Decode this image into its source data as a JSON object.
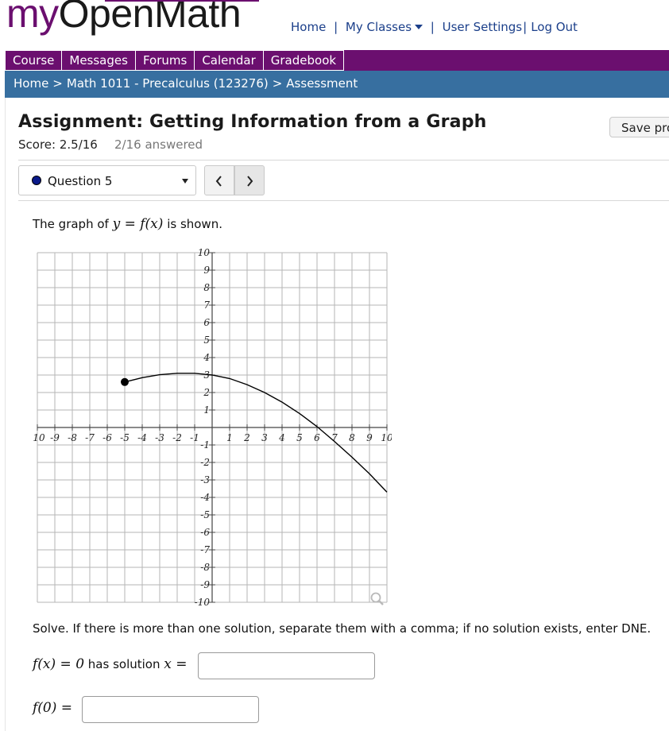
{
  "logo": {
    "my": "my",
    "rest": "OpenMath"
  },
  "topnav": {
    "home": "Home",
    "sep1": "|",
    "my_classes": "My Classes",
    "sep2": "|",
    "user_settings": "User Settings",
    "sep3": "|",
    "logout": "Log Out"
  },
  "tabs": [
    "Course",
    "Messages",
    "Forums",
    "Calendar",
    "Gradebook"
  ],
  "breadcrumb": {
    "home": "Home",
    "course": "Math 1011 - Precalculus (123276)",
    "current": "Assessment",
    "separator": ">"
  },
  "assignment": {
    "title": "Assignment: Getting Information from a Graph",
    "score": "Score: 2.5/16",
    "answered": "2/16 answered",
    "save_label": "Save pro"
  },
  "question_nav": {
    "selected": "Question 5",
    "status_color": "#0a1a8a"
  },
  "question": {
    "intro_before": "The graph of",
    "intro_math": "y = f(x)",
    "intro_after": "is shown.",
    "instructions": "Solve. If there is more than one solution, separate them with a comma; if no solution exists, enter DNE.",
    "part1_math_left": "f(x) = 0",
    "part1_text": "has solution",
    "part1_math_right": "x =",
    "part1_value": "",
    "part2_math": "f(0) =",
    "part2_value": ""
  },
  "graph": {
    "x_ticks": [
      "-10",
      "-9",
      "-8",
      "-7",
      "-6",
      "-5",
      "-4",
      "-3",
      "-2",
      "-1",
      "1",
      "2",
      "3",
      "4",
      "5",
      "6",
      "7",
      "8",
      "9",
      "10"
    ],
    "y_ticks": [
      "10",
      "9",
      "8",
      "7",
      "6",
      "5",
      "4",
      "3",
      "2",
      "1",
      "-1",
      "-2",
      "-3",
      "-4",
      "-5",
      "-6",
      "-7",
      "-8",
      "-9",
      "-10"
    ],
    "xlim": [
      -10,
      10
    ],
    "ylim": [
      -10,
      10
    ],
    "grid": true,
    "curve_points": [
      [
        -5,
        2.6
      ],
      [
        -4,
        2.85
      ],
      [
        -3,
        3.02
      ],
      [
        -2,
        3.1
      ],
      [
        -1,
        3.1
      ],
      [
        0,
        3.0
      ],
      [
        1,
        2.8
      ],
      [
        2,
        2.45
      ],
      [
        3,
        2.0
      ],
      [
        4,
        1.45
      ],
      [
        5,
        0.8
      ],
      [
        6,
        0.05
      ],
      [
        7,
        -0.8
      ],
      [
        8,
        -1.7
      ],
      [
        9,
        -2.65
      ],
      [
        10,
        -3.7
      ]
    ],
    "endpoint": [
      -5,
      2.6
    ],
    "colors": {
      "grid": "#b5b5b5",
      "axis": "#444444",
      "curve": "#000000"
    },
    "zoom_icon": "magnifier-icon"
  }
}
